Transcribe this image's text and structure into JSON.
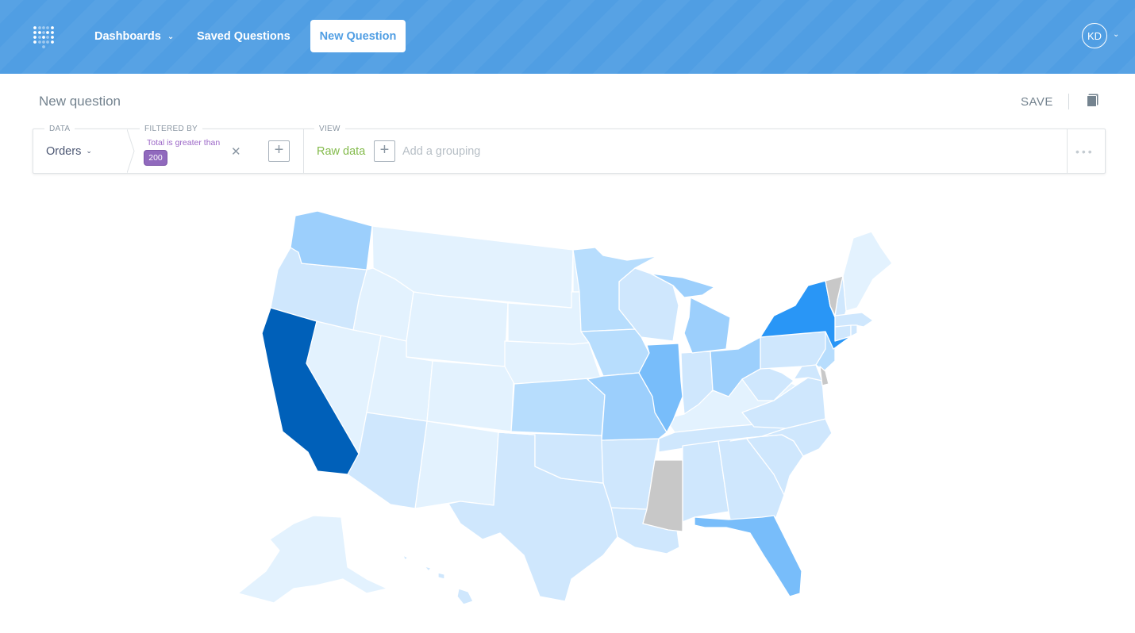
{
  "nav": {
    "logo_icon": "metabase-logo-icon",
    "dashboards": "Dashboards",
    "dashboards_chevron": "⌄",
    "saved_questions": "Saved Questions",
    "new_question": "New Question",
    "user_initials": "KD",
    "user_chevron": "⌄"
  },
  "header": {
    "title": "New question",
    "save": "SAVE",
    "reference_icon": "book-icon"
  },
  "query_builder": {
    "data_label": "DATA",
    "data_value": "Orders",
    "data_chevron": "⌄",
    "filtered_by_label": "FILTERED BY",
    "filter_text": "Total is greater than",
    "filter_value": "200",
    "filter_remove": "✕",
    "add_filter": "+",
    "view_label": "VIEW",
    "view_value": "Raw data",
    "add_grouping_plus": "+",
    "add_grouping": "Add a grouping",
    "more": "•••"
  },
  "colors": {
    "nav_background": "#509ee3",
    "nav_text": "#ffffff",
    "filter_purple": "#9069bd",
    "raw_data_green": "#84bb4c",
    "map_no_data": "#c8c8c8",
    "map_scale": [
      "#e3f2fe",
      "#cfe7fd",
      "#b7ddfd",
      "#9ccffc",
      "#78bdfa",
      "#2996f6",
      "#0060b9"
    ]
  },
  "chart_data": {
    "type": "choropleth-map",
    "region": "United States",
    "color_levels": [
      {
        "states": [
          "Montana",
          "Idaho",
          "Wyoming",
          "Nevada",
          "Utah",
          "Colorado",
          "North Dakota",
          "South Dakota",
          "Nebraska",
          "New Mexico",
          "Kentucky",
          "Maine",
          "Alaska"
        ],
        "level": 0
      },
      {
        "states": [
          "Oregon",
          "Arizona",
          "Texas",
          "Oklahoma",
          "Louisiana",
          "Arkansas",
          "Tennessee",
          "Alabama",
          "Georgia",
          "South Carolina",
          "North Carolina",
          "Virginia",
          "Wisconsin",
          "Indiana",
          "West Virginia",
          "Pennsylvania",
          "Hawaii",
          "New Hampshire",
          "Massachusetts",
          "Connecticut",
          "Rhode Island",
          "Maryland"
        ],
        "level": 1
      },
      {
        "states": [
          "Minnesota",
          "Iowa",
          "Kansas",
          "New Jersey"
        ],
        "level": 2
      },
      {
        "states": [
          "Washington",
          "Michigan",
          "Missouri",
          "Ohio"
        ],
        "level": 3
      },
      {
        "states": [
          "Illinois",
          "Florida"
        ],
        "level": 4
      },
      {
        "states": [
          "New York"
        ],
        "level": 5
      },
      {
        "states": [
          "California"
        ],
        "level": 6
      },
      {
        "states": [
          "Mississippi",
          "Vermont",
          "Delaware"
        ],
        "level": "no-data"
      }
    ]
  }
}
